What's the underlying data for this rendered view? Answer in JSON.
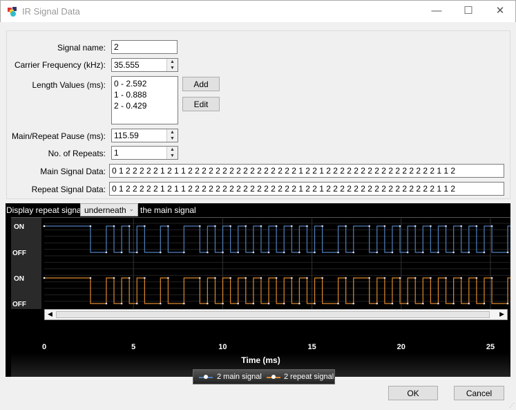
{
  "window": {
    "title": "IR Signal Data",
    "icon": "app-cube-icon",
    "minimize": "—",
    "maximize": "☐",
    "close": "✕"
  },
  "form": {
    "signal_name_label": "Signal name:",
    "signal_name": "2",
    "carrier_label": "Carrier Frequency (kHz):",
    "carrier": "35.555",
    "lengths_label": "Length Values (ms):",
    "lengths": [
      "0 - 2.592",
      "1 - 0.888",
      "2 - 0.429"
    ],
    "add": "Add",
    "edit": "Edit",
    "pause_label": "Main/Repeat Pause (ms):",
    "pause": "115.59",
    "repeats_label": "No. of Repeats:",
    "repeats": "1",
    "main_label": "Main Signal Data:",
    "main_data": "0 1 2 2 2 2 2 1 2 1 1 2 2 2 2 2 2 2 2 2 2 2 2 2 2 2 2 1 2 2 1 2 2 2 2 2 2 2 2 2 2 2 2 2 2 2 2 1 1 2",
    "repeat_label": "Repeat Signal Data:",
    "repeat_data": "0 1 2 2 2 2 2 1 2 1 1 2 2 2 2 2 2 2 2 2 2 2 2 2 2 2 2 1 2 2 1 2 2 2 2 2 2 2 2 2 2 2 2 2 2 2 2 1 1 2"
  },
  "chart_ctl": {
    "prefix": "Display repeat signal",
    "mode": "underneath",
    "suffix": "the main signal"
  },
  "chart_data": {
    "type": "line",
    "xlabel": "Time (ms)",
    "xlim": [
      0,
      26
    ],
    "xticks": [
      "0",
      "5",
      "10",
      "15",
      "20",
      "25"
    ],
    "ylabels": [
      "ON",
      "OFF",
      "ON",
      "OFF"
    ],
    "length_values_ms": {
      "0": 2.592,
      "1": 0.888,
      "2": 0.429
    },
    "series": [
      {
        "name": "2 main signal",
        "color": "#4f81bd"
      },
      {
        "name": "2 repeat signal",
        "color": "#e0892c"
      }
    ],
    "legend": "bottom-center"
  },
  "footer": {
    "ok": "OK",
    "cancel": "Cancel"
  }
}
